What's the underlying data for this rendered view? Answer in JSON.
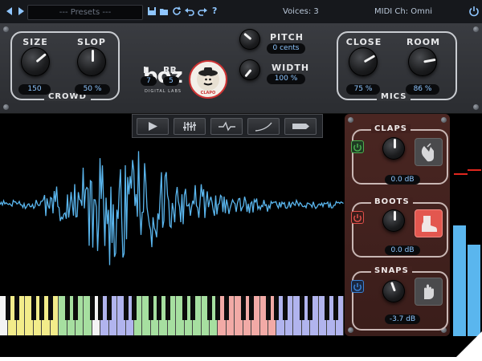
{
  "topbar": {
    "preset_label": "--- Presets ---",
    "voices": "Voices: 3",
    "midi": "MIDI Ch: Omni",
    "icons": [
      "prev-arrow-icon",
      "next-arrow-icon",
      "save-icon",
      "folder-icon",
      "refresh-icon",
      "undo-icon",
      "redo-icon",
      "help-icon",
      "power-icon"
    ]
  },
  "crowd": {
    "group_label": "Crowd",
    "size": {
      "label": "Size",
      "value": "150"
    },
    "slop": {
      "label": "Slop",
      "value": "50 %"
    }
  },
  "logo": {
    "brand": "boz",
    "sub": "DIGITAL LABS",
    "badge": "EL CLAPO"
  },
  "l_rr": {
    "l_label": "L",
    "l_value": "7",
    "rr_label": "RR",
    "rr_value": "5"
  },
  "pitch": {
    "label": "Pitch",
    "value": "0 cents"
  },
  "width": {
    "label": "Width",
    "value": "100 %"
  },
  "mics": {
    "group_label": "Mics",
    "close": {
      "label": "Close",
      "value": "75 %"
    },
    "room": {
      "label": "Room",
      "value": "86 %"
    }
  },
  "transport": {
    "buttons": [
      "play-icon",
      "mixer-icon",
      "envelope-icon",
      "curve-icon",
      "output-icon"
    ]
  },
  "channels": [
    {
      "label": "Claps",
      "value": "0.0 dB",
      "power_color": "#4caf50",
      "power_on": true,
      "icon": "clap-hands-icon"
    },
    {
      "label": "Boots",
      "value": "0.0 dB",
      "power_color": "#e0504a",
      "power_on": false,
      "icon": "boot-icon"
    },
    {
      "label": "Snaps",
      "value": "-3.7 dB",
      "power_color": "#3b82d6",
      "power_on": true,
      "icon": "snap-hand-icon"
    }
  ],
  "meters": {
    "left_level": 0.5,
    "right_level": 0.41
  },
  "colors": {
    "accent": "#5ab6ee",
    "panel_red": "#4a2622",
    "key_yellow": "#f2ec8a",
    "key_green": "#a6dfa0",
    "key_red": "#f2aaa6",
    "key_blue": "#b1b4ee"
  }
}
